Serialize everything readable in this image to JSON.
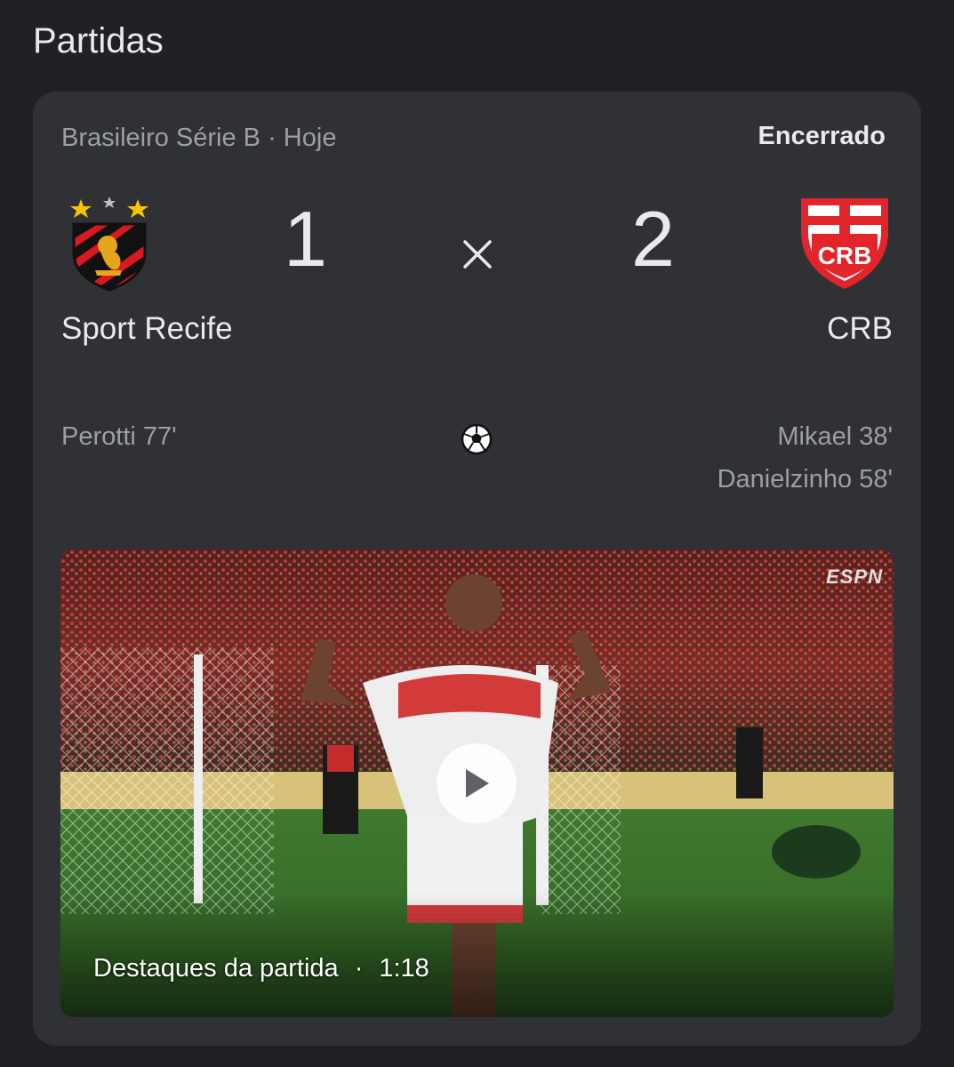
{
  "section": {
    "title": "Partidas"
  },
  "match": {
    "competition": "Brasileiro Série B · Hoje",
    "status": "Encerrado",
    "home": {
      "name": "Sport Recife",
      "score": "1",
      "crest_icon": "sport-recife-crest",
      "scorers": [
        "Perotti 77'"
      ]
    },
    "away": {
      "name": "CRB",
      "score": "2",
      "crest_icon": "crb-crest",
      "crest_text": "CRB",
      "scorers": [
        "Mikael 38'",
        "Danielzinho 58'"
      ]
    },
    "separator": "×",
    "goal_icon": "soccer-ball-icon"
  },
  "video": {
    "caption": "Destaques da partida",
    "separator": "·",
    "duration": "1:18",
    "broadcaster": "ESPN",
    "play_icon": "play-icon"
  },
  "colors": {
    "background": "#202124",
    "card": "#303134",
    "text_primary": "#e8eaed",
    "text_secondary": "#9aa0a6",
    "crb_red": "#e2252b",
    "sport_red": "#d71920"
  }
}
